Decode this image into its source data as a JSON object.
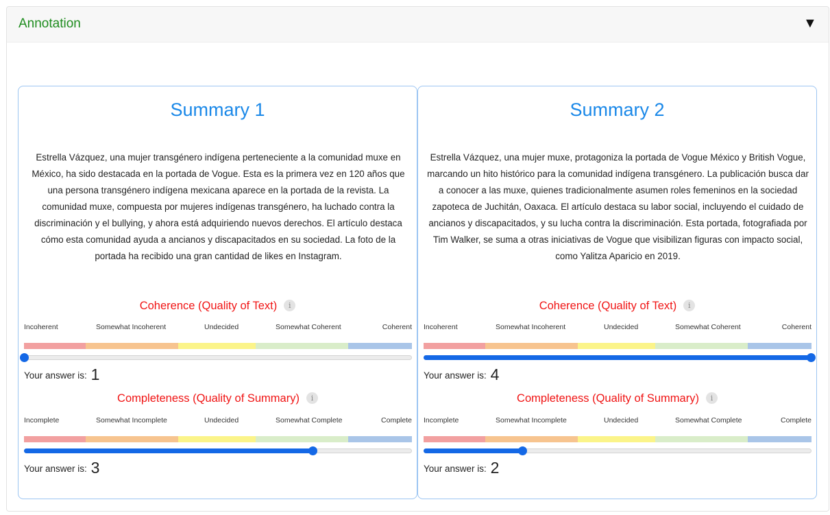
{
  "panel": {
    "title": "Annotation",
    "toggle_icon": "▼"
  },
  "scales": {
    "coherence": {
      "title": "Coherence (Quality of Text)",
      "labels": [
        "Incoherent",
        "Somewhat Incoherent",
        "Undecided",
        "Somewhat Coherent",
        "Coherent"
      ]
    },
    "completeness": {
      "title": "Completeness (Quality of Summary)",
      "labels": [
        "Incomplete",
        "Somewhat Incomplete",
        "Undecided",
        "Somewhat Complete",
        "Complete"
      ]
    },
    "info_icon": "i",
    "answer_prefix": "Your answer is:",
    "segment_colors": [
      "#f2a0a0",
      "#f7c48f",
      "#fbf489",
      "#d9edc9",
      "#a9c5e8"
    ],
    "accent_color": "#1468e6"
  },
  "summaries": [
    {
      "title": "Summary 1",
      "text": "Estrella Vázquez, una mujer transgénero indígena perteneciente a la comunidad muxe en México, ha sido destacada en la portada de Vogue. Esta es la primera vez en 120 años que una persona transgénero indígena mexicana aparece en la portada de la revista. La comunidad muxe, compuesta por mujeres indígenas transgénero, ha luchado contra la discriminación y el bullying, y ahora está adquiriendo nuevos derechos. El artículo destaca cómo esta comunidad ayuda a ancianos y discapacitados en su sociedad. La foto de la portada ha recibido una gran cantidad de likes en Instagram.",
      "coherence": {
        "value": 1,
        "slider_fraction": 0.0
      },
      "completeness": {
        "value": 3,
        "slider_fraction": 0.745
      }
    },
    {
      "title": "Summary 2",
      "text": "Estrella Vázquez, una mujer muxe, protagoniza la portada de Vogue México y British Vogue, marcando un hito histórico para la comunidad indígena transgénero. La publicación busca dar a conocer a las muxe, quienes tradicionalmente asumen roles femeninos en la sociedad zapoteca de Juchitán, Oaxaca. El artículo destaca su labor social, incluyendo el cuidado de ancianos y discapacitados, y su lucha contra la discriminación. Esta portada, fotografiada por Tim Walker, se suma a otras iniciativas de Vogue que visibilizan figuras con impacto social, como Yalitza Aparicio en 2019.",
      "coherence": {
        "value": 4,
        "slider_fraction": 1.0
      },
      "completeness": {
        "value": 2,
        "slider_fraction": 0.255
      }
    }
  ]
}
